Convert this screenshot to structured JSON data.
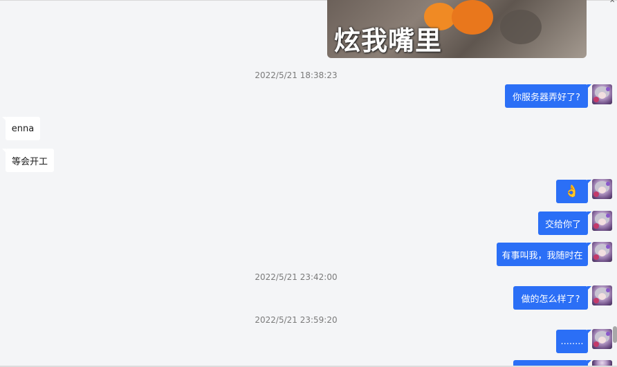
{
  "sticker": {
    "caption": "炫我嘴里"
  },
  "timestamps": [
    "2022/5/21 18:38:23",
    "2022/5/21 23:42:00",
    "2022/5/21 23:59:20"
  ],
  "messages": [
    {
      "side": "out",
      "text": "你服务器弄好了?"
    },
    {
      "side": "in",
      "text": "enna"
    },
    {
      "side": "in",
      "text": "等会开工"
    },
    {
      "side": "out",
      "text": "👌"
    },
    {
      "side": "out",
      "text": "交给你了"
    },
    {
      "side": "out",
      "text": "有事叫我，我随时在"
    },
    {
      "side": "out",
      "text": "做的怎么样了?"
    },
    {
      "side": "out",
      "text": "........"
    }
  ],
  "colors": {
    "outgoing_bubble": "#2b6ff6",
    "incoming_bubble": "#ffffff",
    "background": "#f4f5f7"
  }
}
